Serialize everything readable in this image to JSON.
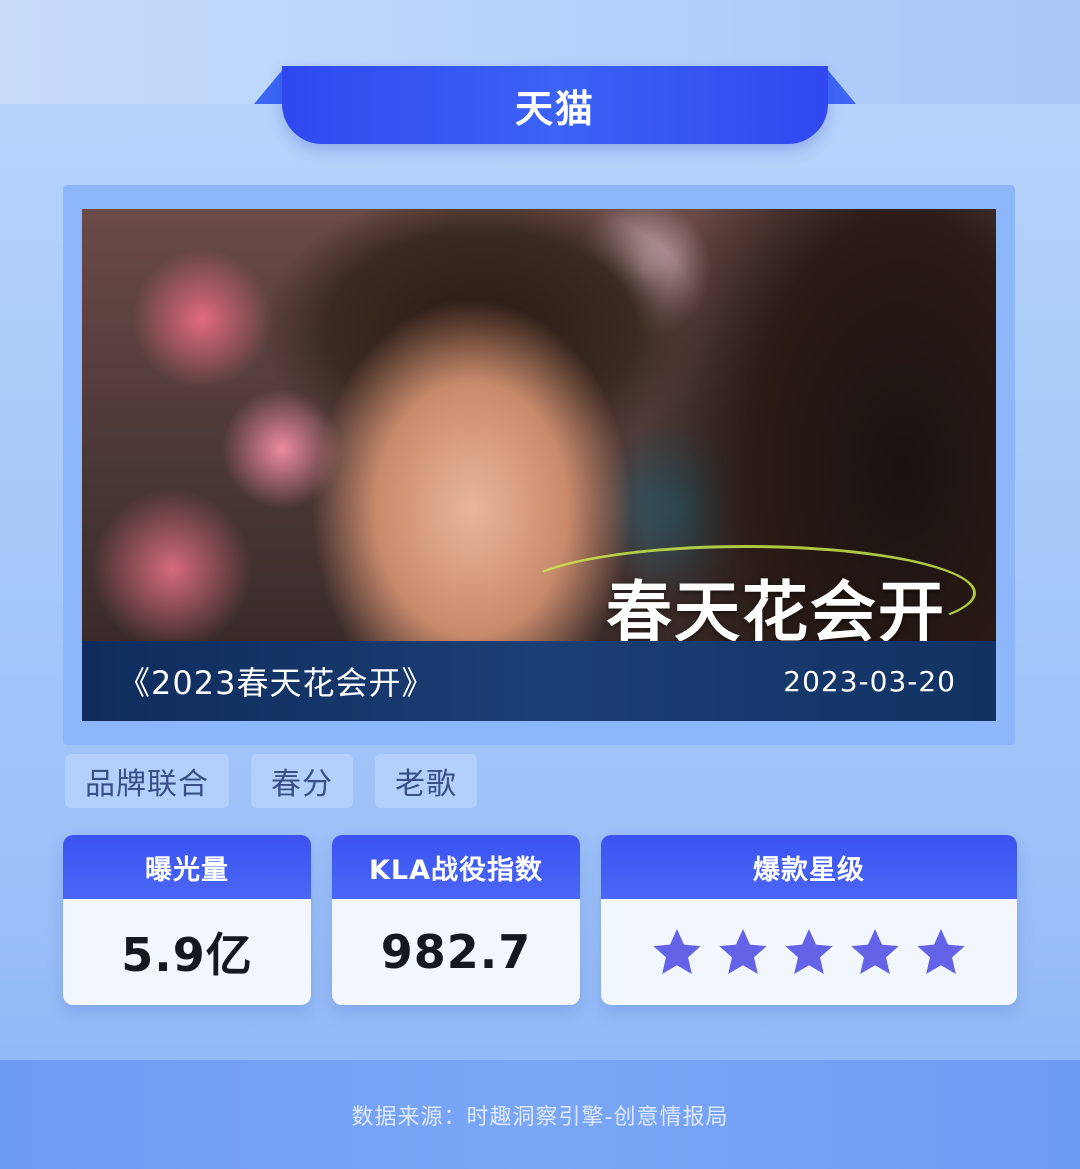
{
  "header": {
    "title": "天猫"
  },
  "campaign": {
    "name": "《2023春天花会开》",
    "date": "2023-03-20",
    "image_overlay_text": "春天花会开"
  },
  "tags": [
    "品牌联合",
    "春分",
    "老歌"
  ],
  "metrics": {
    "exposure": {
      "label": "曝光量",
      "value": "5.9亿"
    },
    "kla": {
      "label": "KLA战役指数",
      "value": "982.7"
    },
    "stars": {
      "label": "爆款星级",
      "rating": 5,
      "max": 5,
      "star_color": "#6462e6"
    }
  },
  "footer": {
    "source": "数据来源：时趣洞察引擎-创意情报局"
  },
  "colors": {
    "accent": "#3c53f2",
    "caption_bar": "#1b3e74",
    "tag_bg": "#b2d0fb"
  }
}
